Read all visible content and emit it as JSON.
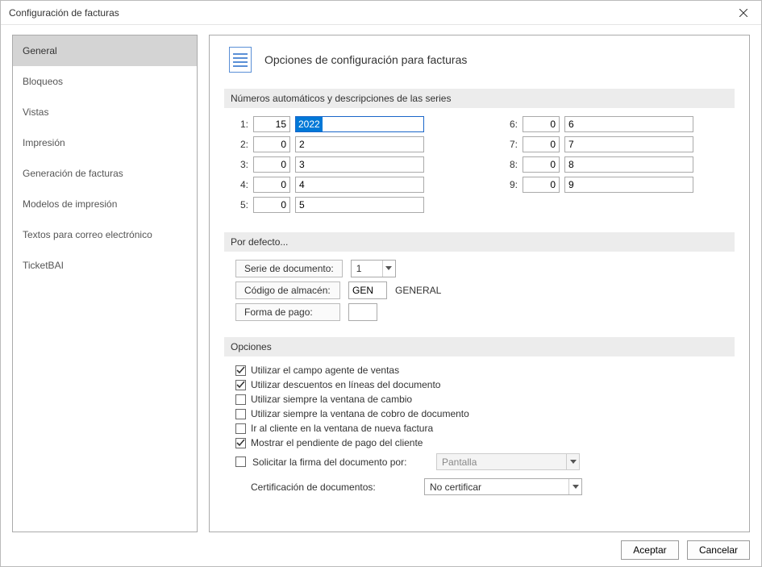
{
  "window": {
    "title": "Configuración de facturas"
  },
  "sidebar": {
    "items": [
      {
        "label": "General",
        "selected": true
      },
      {
        "label": "Bloqueos",
        "selected": false
      },
      {
        "label": "Vistas",
        "selected": false
      },
      {
        "label": "Impresión",
        "selected": false
      },
      {
        "label": "Generación de facturas",
        "selected": false
      },
      {
        "label": "Modelos de impresión",
        "selected": false
      },
      {
        "label": "Textos para correo electrónico",
        "selected": false
      },
      {
        "label": "TicketBAI",
        "selected": false
      }
    ]
  },
  "main": {
    "title": "Opciones de configuración para facturas",
    "section_series_header": "Números automáticos y descripciones de las series",
    "series": {
      "left": [
        {
          "label": "1:",
          "num": "15",
          "desc": "2022",
          "highlighted": true
        },
        {
          "label": "2:",
          "num": "0",
          "desc": "2"
        },
        {
          "label": "3:",
          "num": "0",
          "desc": "3"
        },
        {
          "label": "4:",
          "num": "0",
          "desc": "4"
        },
        {
          "label": "5:",
          "num": "0",
          "desc": "5"
        }
      ],
      "right": [
        {
          "label": "6:",
          "num": "0",
          "desc": "6"
        },
        {
          "label": "7:",
          "num": "0",
          "desc": "7"
        },
        {
          "label": "8:",
          "num": "0",
          "desc": "8"
        },
        {
          "label": "9:",
          "num": "0",
          "desc": "9"
        }
      ]
    },
    "section_defaults_header": "Por defecto...",
    "defaults": {
      "serie_label": "Serie de documento:",
      "serie_value": "1",
      "almacen_label": "Código de almacén:",
      "almacen_code": "GEN",
      "almacen_name": "GENERAL",
      "pago_label": "Forma de pago:",
      "pago_value": ""
    },
    "section_options_header": "Opciones",
    "options": [
      {
        "label": "Utilizar el campo agente de ventas",
        "checked": true
      },
      {
        "label": "Utilizar descuentos en líneas del documento",
        "checked": true
      },
      {
        "label": "Utilizar siempre la ventana de cambio",
        "checked": false
      },
      {
        "label": "Utilizar siempre la ventana de cobro de documento",
        "checked": false
      },
      {
        "label": "Ir al cliente en la ventana de nueva factura",
        "checked": false
      },
      {
        "label": "Mostrar el pendiente de pago del cliente",
        "checked": true
      }
    ],
    "firma": {
      "label": "Solicitar la firma del documento por:",
      "checked": false,
      "value": "Pantalla",
      "disabled": true
    },
    "cert": {
      "label": "Certificación de documentos:",
      "value": "No certificar"
    }
  },
  "footer": {
    "accept": "Aceptar",
    "cancel": "Cancelar"
  }
}
